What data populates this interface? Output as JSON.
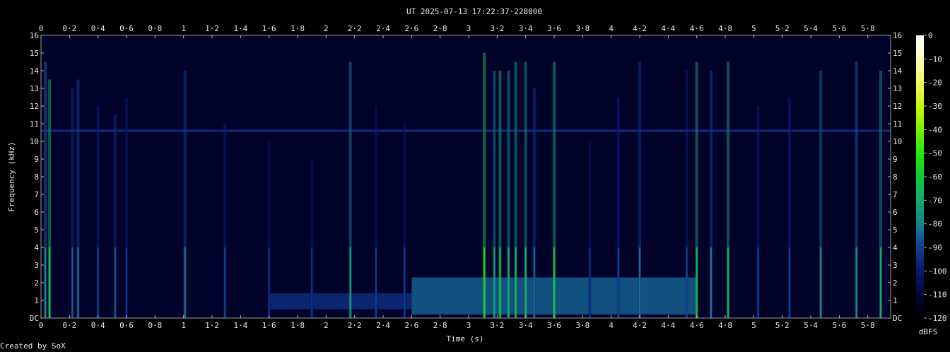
{
  "chart_data": {
    "type": "heatmap",
    "title": "UT 2025-07-13 17:22:37·228000",
    "xlabel": "Time (s)",
    "ylabel": "Frequency (kHz)",
    "xlim": [
      0,
      5.96
    ],
    "ylim": [
      0,
      16
    ],
    "x_ticks": [
      "0",
      "0·2",
      "0·4",
      "0·6",
      "0·8",
      "1",
      "1·2",
      "1·4",
      "1·6",
      "1·8",
      "2",
      "2·2",
      "2·4",
      "2·6",
      "2·8",
      "3",
      "3·2",
      "3·4",
      "3·6",
      "3·8",
      "4",
      "4·2",
      "4·4",
      "4·6",
      "4·8",
      "5",
      "5·2",
      "5·4",
      "5·6",
      "5·8"
    ],
    "y_ticks": [
      "DC",
      "1",
      "2",
      "3",
      "4",
      "5",
      "6",
      "7",
      "8",
      "9",
      "10",
      "11",
      "12",
      "13",
      "14",
      "15",
      "16"
    ],
    "colorbar": {
      "label": "dBFS",
      "range": [
        -120,
        0
      ],
      "ticks": [
        "0",
        "-10",
        "-20",
        "-30",
        "-40",
        "-50",
        "-60",
        "-70",
        "-80",
        "-90",
        "-100",
        "-110",
        "-120"
      ]
    },
    "tone_line": {
      "freq_khz": 10.6,
      "level_dbfs": -95
    },
    "broadband_events": [
      {
        "t": 0.03,
        "level_dbfs": -75,
        "fmax_khz": 14.5
      },
      {
        "t": 0.06,
        "level_dbfs": -60,
        "fmax_khz": 13.5
      },
      {
        "t": 0.22,
        "level_dbfs": -85,
        "fmax_khz": 13
      },
      {
        "t": 0.26,
        "level_dbfs": -80,
        "fmax_khz": 13.5
      },
      {
        "t": 0.4,
        "level_dbfs": -88,
        "fmax_khz": 12
      },
      {
        "t": 0.52,
        "level_dbfs": -85,
        "fmax_khz": 11.5
      },
      {
        "t": 0.6,
        "level_dbfs": -90,
        "fmax_khz": 12.5
      },
      {
        "t": 1.01,
        "level_dbfs": -80,
        "fmax_khz": 14
      },
      {
        "t": 1.29,
        "level_dbfs": -88,
        "fmax_khz": 11
      },
      {
        "t": 1.6,
        "level_dbfs": -92,
        "fmax_khz": 10
      },
      {
        "t": 1.9,
        "level_dbfs": -92,
        "fmax_khz": 9
      },
      {
        "t": 2.17,
        "level_dbfs": -72,
        "fmax_khz": 14.5
      },
      {
        "t": 2.35,
        "level_dbfs": -90,
        "fmax_khz": 12
      },
      {
        "t": 2.55,
        "level_dbfs": -90,
        "fmax_khz": 11
      },
      {
        "t": 3.11,
        "level_dbfs": -55,
        "fmax_khz": 15
      },
      {
        "t": 3.18,
        "level_dbfs": -72,
        "fmax_khz": 14
      },
      {
        "t": 3.22,
        "level_dbfs": -62,
        "fmax_khz": 14
      },
      {
        "t": 3.28,
        "level_dbfs": -68,
        "fmax_khz": 14
      },
      {
        "t": 3.33,
        "level_dbfs": -66,
        "fmax_khz": 14.5
      },
      {
        "t": 3.4,
        "level_dbfs": -68,
        "fmax_khz": 14.5
      },
      {
        "t": 3.46,
        "level_dbfs": -82,
        "fmax_khz": 13
      },
      {
        "t": 3.6,
        "level_dbfs": -62,
        "fmax_khz": 14.5
      },
      {
        "t": 3.85,
        "level_dbfs": -92,
        "fmax_khz": 10
      },
      {
        "t": 4.05,
        "level_dbfs": -88,
        "fmax_khz": 12.5
      },
      {
        "t": 4.2,
        "level_dbfs": -82,
        "fmax_khz": 14.5
      },
      {
        "t": 4.53,
        "level_dbfs": -88,
        "fmax_khz": 14
      },
      {
        "t": 4.6,
        "level_dbfs": -65,
        "fmax_khz": 14.5
      },
      {
        "t": 4.7,
        "level_dbfs": -80,
        "fmax_khz": 14
      },
      {
        "t": 4.82,
        "level_dbfs": -65,
        "fmax_khz": 14.5
      },
      {
        "t": 5.03,
        "level_dbfs": -88,
        "fmax_khz": 12
      },
      {
        "t": 5.25,
        "level_dbfs": -88,
        "fmax_khz": 12.5
      },
      {
        "t": 5.47,
        "level_dbfs": -75,
        "fmax_khz": 14
      },
      {
        "t": 5.72,
        "level_dbfs": -75,
        "fmax_khz": 14.5
      },
      {
        "t": 5.89,
        "level_dbfs": -68,
        "fmax_khz": 14
      }
    ],
    "sustained_bands": [
      {
        "t_start": 2.6,
        "t_end": 4.6,
        "f_low_khz": 0.2,
        "f_high_khz": 2.3,
        "level_dbfs": -85
      },
      {
        "t_start": 1.6,
        "t_end": 2.6,
        "f_low_khz": 0.5,
        "f_high_khz": 1.4,
        "level_dbfs": -95
      }
    ]
  },
  "credit": "Created by SoX"
}
